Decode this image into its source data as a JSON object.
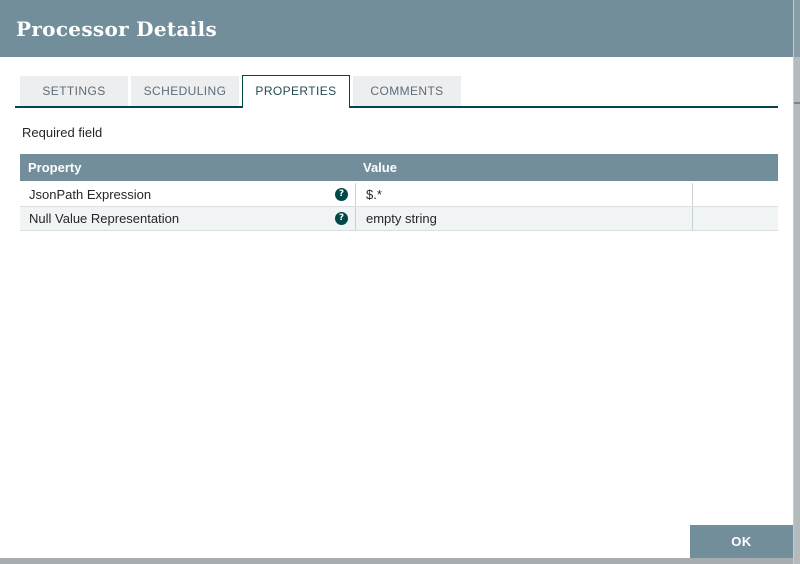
{
  "dialog": {
    "title": "Processor Details"
  },
  "tabs": [
    {
      "label": "SETTINGS",
      "active": false
    },
    {
      "label": "SCHEDULING",
      "active": false
    },
    {
      "label": "PROPERTIES",
      "active": true
    },
    {
      "label": "COMMENTS",
      "active": false
    }
  ],
  "required_field_label": "Required field",
  "table": {
    "columns": {
      "property": "Property",
      "value": "Value"
    },
    "rows": [
      {
        "property": "JsonPath Expression",
        "help_icon": "?",
        "value": "$.*"
      },
      {
        "property": "Null Value Representation",
        "help_icon": "?",
        "value": "empty string"
      }
    ]
  },
  "footer": {
    "ok_label": "OK"
  },
  "colors": {
    "header_bg": "#728e9b",
    "tab_active_border": "#004849",
    "tab_inactive_bg": "#eceeef",
    "table_header_bg": "#728e9b",
    "row_alt_bg": "#f1f4f5",
    "help_icon_bg": "#004849",
    "ok_button_bg": "#728e9b"
  }
}
